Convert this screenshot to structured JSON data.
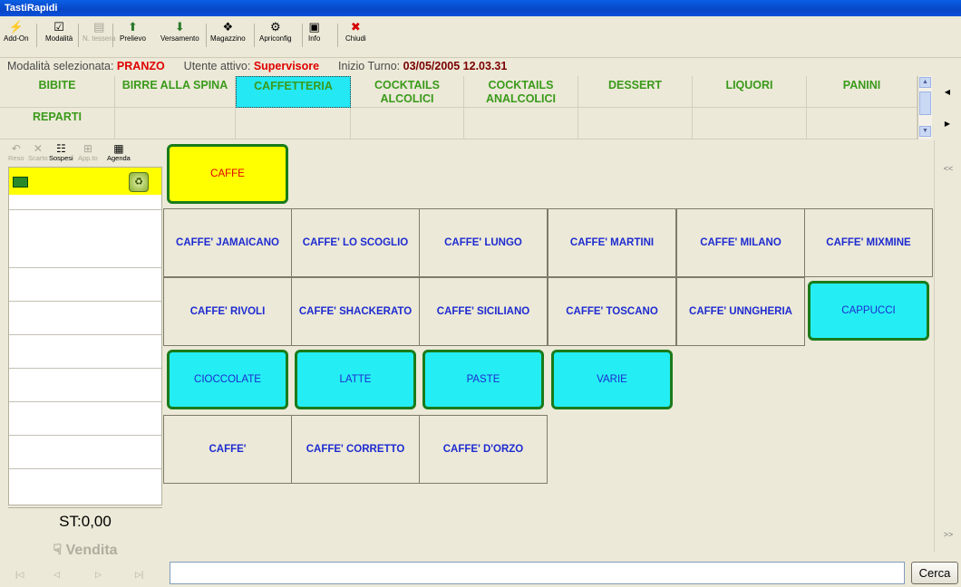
{
  "window": {
    "title": "TastiRapidi"
  },
  "toolbar": {
    "items": [
      {
        "label": "Add-On",
        "icon": "lightning-icon",
        "glyph": "⚡",
        "enabled": true
      },
      {
        "label": "Modalità",
        "icon": "checkbox-icon",
        "glyph": "☑",
        "enabled": true
      },
      {
        "label": "N. tessera",
        "icon": "card-icon",
        "glyph": "▤",
        "enabled": false
      },
      {
        "label": "Prelievo",
        "icon": "arrow-up-icon",
        "glyph": "⬆",
        "enabled": true
      },
      {
        "label": "Versamento",
        "icon": "arrow-down-icon",
        "glyph": "⬇",
        "enabled": true
      },
      {
        "label": "Magazzino",
        "icon": "warehouse-icon",
        "glyph": "❖",
        "enabled": true
      },
      {
        "label": "Apriconfig",
        "icon": "config-icon",
        "glyph": "⚙",
        "enabled": true
      },
      {
        "label": "Info",
        "icon": "info-icon",
        "glyph": "▣",
        "enabled": true
      },
      {
        "label": "Chiudi",
        "icon": "close-icon",
        "glyph": "✖",
        "enabled": true
      }
    ]
  },
  "status": {
    "mode_label": "Modalità selezionata:",
    "mode_value": "PRANZO",
    "user_label": "Utente attivo:",
    "user_value": "Supervisore",
    "shift_label": "Inizio Turno:",
    "shift_value": "03/05/2005 12.03.31"
  },
  "categories": [
    {
      "label": "BIBITE",
      "selected": false
    },
    {
      "label": "BIRRE ALLA SPINA",
      "selected": false
    },
    {
      "label": "CAFFETTERIA",
      "selected": true
    },
    {
      "label": "COCKTAILS ALCOLICI",
      "selected": false
    },
    {
      "label": "COCKTAILS ANALCOLICI",
      "selected": false
    },
    {
      "label": "DESSERT",
      "selected": false
    },
    {
      "label": "LIQUORI",
      "selected": false
    },
    {
      "label": "PANINI",
      "selected": false
    },
    {
      "label": "REPARTI",
      "selected": false
    },
    {
      "label": "",
      "selected": false
    },
    {
      "label": "",
      "selected": false
    },
    {
      "label": "",
      "selected": false
    },
    {
      "label": "",
      "selected": false
    },
    {
      "label": "",
      "selected": false
    },
    {
      "label": "",
      "selected": false
    },
    {
      "label": "",
      "selected": false
    }
  ],
  "left_toolbar": [
    {
      "label": "Reso",
      "icon": "undo-icon",
      "glyph": "↶",
      "enabled": false
    },
    {
      "label": "Scarto",
      "icon": "discard-icon",
      "glyph": "✕",
      "enabled": false
    },
    {
      "label": "Sospesi",
      "icon": "suspended-icon",
      "glyph": "☷",
      "enabled": true
    },
    {
      "label": "App.to",
      "icon": "appointment-icon",
      "glyph": "⊞",
      "enabled": false
    },
    {
      "label": "Agenda",
      "icon": "agenda-icon",
      "glyph": "▦",
      "enabled": true
    }
  ],
  "receipt": {
    "subtotal": "ST:0,00",
    "sell_button": "Vendita",
    "nav": [
      "|◁",
      "◁",
      "▷",
      "▷|"
    ]
  },
  "products": [
    {
      "label": "CAFFE",
      "style": "yellow"
    },
    {
      "label": "CAFFE' JAMAICANO",
      "style": "plain"
    },
    {
      "label": "CAFFE' LO SCOGLIO",
      "style": "plain"
    },
    {
      "label": "CAFFE' LUNGO",
      "style": "plain"
    },
    {
      "label": "CAFFE' MARTINI",
      "style": "plain"
    },
    {
      "label": "CAFFE' MILANO",
      "style": "plain"
    },
    {
      "label": "CAFFE' MIXMINE",
      "style": "plain"
    },
    {
      "label": "CAFFE' RIVOLI",
      "style": "plain"
    },
    {
      "label": "CAFFE' SHACKERATO",
      "style": "plain"
    },
    {
      "label": "CAFFE' SICILIANO",
      "style": "plain"
    },
    {
      "label": "CAFFE' TOSCANO",
      "style": "plain"
    },
    {
      "label": "CAFFE' UNNGHERIA",
      "style": "plain"
    },
    {
      "label": "CAPPUCCI",
      "style": "cyan"
    },
    {
      "label": "CIOCCOLATE",
      "style": "cyan"
    },
    {
      "label": "LATTE",
      "style": "cyan"
    },
    {
      "label": "PASTE",
      "style": "cyan"
    },
    {
      "label": "VARIE",
      "style": "cyan"
    },
    {
      "label": "CAFFE'",
      "style": "plain"
    },
    {
      "label": "CAFFE' CORRETTO",
      "style": "plain"
    },
    {
      "label": "CAFFE' D'ORZO",
      "style": "plain"
    }
  ],
  "right_panel": {
    "collapse_top": "<<",
    "collapse_bottom": ">>"
  },
  "search": {
    "value": "",
    "button_label": "Cerca"
  },
  "colors": {
    "selected_category": "#24e8f4",
    "cyan_button": "#24eef4",
    "yellow_button": "#ffff00",
    "button_border": "#1a7b1a",
    "category_text": "#3a9a1a",
    "product_text": "#1e2bd0"
  }
}
